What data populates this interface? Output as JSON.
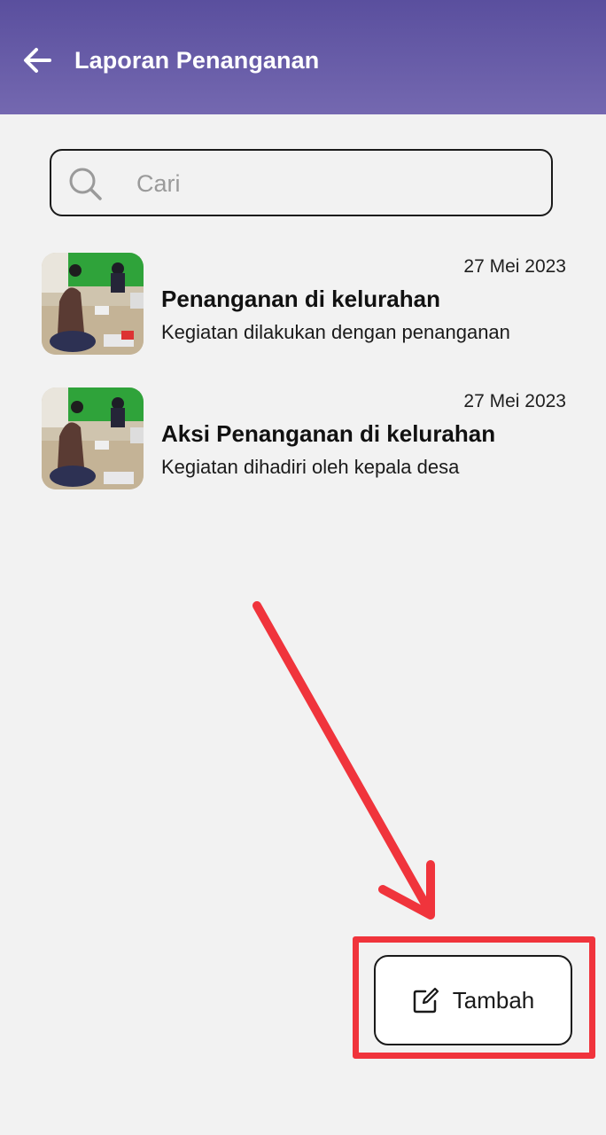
{
  "header": {
    "title": "Laporan Penanganan",
    "back_icon": "arrow-left-icon",
    "background": "#5a4f9e"
  },
  "search": {
    "placeholder": "Cari",
    "value": "",
    "icon": "search-icon"
  },
  "reports": [
    {
      "date": "27 Mei 2023",
      "title": "Penanganan di kelurahan",
      "description": "Kegiatan dilakukan dengan penanganan"
    },
    {
      "date": "27 Mei 2023",
      "title": "Aksi Penanganan di kelurahan",
      "description": "Kegiatan dihadiri oleh kepala desa"
    }
  ],
  "fab": {
    "label": "Tambah",
    "icon": "edit-icon"
  },
  "annotation": {
    "color": "#f0343c",
    "type": "arrow-and-box-highlight"
  }
}
